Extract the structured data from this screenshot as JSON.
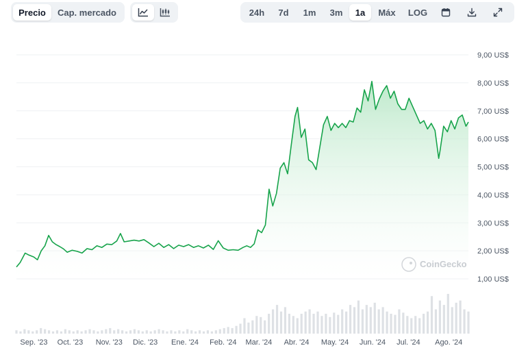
{
  "toolbar": {
    "views": [
      {
        "label": "Precio",
        "active": true
      },
      {
        "label": "Cap. mercado",
        "active": false
      }
    ],
    "chart_types": [
      {
        "icon": "line-chart-icon",
        "active": true
      },
      {
        "icon": "candlestick-chart-icon",
        "active": false
      }
    ],
    "ranges": [
      {
        "label": "24h",
        "active": false
      },
      {
        "label": "7d",
        "active": false
      },
      {
        "label": "1m",
        "active": false
      },
      {
        "label": "3m",
        "active": false
      },
      {
        "label": "1a",
        "active": true
      },
      {
        "label": "Máx",
        "active": false
      }
    ],
    "log_label": "LOG",
    "tools": [
      "calendar-icon",
      "download-icon",
      "fullscreen-icon"
    ]
  },
  "watermark": "CoinGecko",
  "colors": {
    "line": "#16a34a",
    "fill_top": "#b7e7c6",
    "volume": "#d6d9de",
    "grid": "#eef0f3"
  },
  "chart_data": {
    "type": "area",
    "title": "",
    "xlabel": "",
    "ylabel": "",
    "ylim": [
      1.0,
      9.0
    ],
    "y_ticks": [
      1,
      2,
      3,
      4,
      5,
      6,
      7,
      8,
      9
    ],
    "y_tick_labels": [
      "1,00 US$",
      "2,00 US$",
      "3,00 US$",
      "4,00 US$",
      "5,00 US$",
      "6,00 US$",
      "7,00 US$",
      "8,00 US$",
      "9,00 US$"
    ],
    "x_range": [
      "2023-08-29",
      "2024-08-28"
    ],
    "x_ticks": [
      {
        "date": "2023-09-01",
        "label": "Sep. '23"
      },
      {
        "date": "2023-10-01",
        "label": "Oct. '23"
      },
      {
        "date": "2023-11-01",
        "label": "Nov. '23"
      },
      {
        "date": "2023-12-01",
        "label": "Dic. '23"
      },
      {
        "date": "2024-01-01",
        "label": "Ene. '24"
      },
      {
        "date": "2024-02-01",
        "label": "Feb. '24"
      },
      {
        "date": "2024-03-01",
        "label": "Mar. '24"
      },
      {
        "date": "2024-04-01",
        "label": "Abr. '24"
      },
      {
        "date": "2024-05-01",
        "label": "May. '24"
      },
      {
        "date": "2024-06-01",
        "label": "Jun. '24"
      },
      {
        "date": "2024-07-01",
        "label": "Jul. '24"
      },
      {
        "date": "2024-08-01",
        "label": "Ago. '24"
      }
    ],
    "grid": true,
    "legend": "none",
    "series": [
      {
        "x": [
          "2023-08-29",
          "2023-09-01",
          "2023-09-05",
          "2023-09-08",
          "2023-09-12",
          "2023-09-15",
          "2023-09-18",
          "2023-09-21",
          "2023-09-24",
          "2023-09-27",
          "2023-09-30",
          "2023-10-03",
          "2023-10-06",
          "2023-10-09",
          "2023-10-13",
          "2023-10-17",
          "2023-10-21",
          "2023-10-25",
          "2023-10-29",
          "2023-11-02",
          "2023-11-06",
          "2023-11-10",
          "2023-11-14",
          "2023-11-18",
          "2023-11-21",
          "2023-11-24",
          "2023-11-28",
          "2023-12-02",
          "2023-12-06",
          "2023-12-10",
          "2023-12-14",
          "2023-12-18",
          "2023-12-22",
          "2023-12-26",
          "2023-12-30",
          "2024-01-03",
          "2024-01-07",
          "2024-01-11",
          "2024-01-15",
          "2024-01-19",
          "2024-01-23",
          "2024-01-27",
          "2024-01-31",
          "2024-02-04",
          "2024-02-08",
          "2024-02-12",
          "2024-02-16",
          "2024-02-20",
          "2024-02-24",
          "2024-02-28",
          "2024-03-02",
          "2024-03-05",
          "2024-03-08",
          "2024-03-11",
          "2024-03-14",
          "2024-03-17",
          "2024-03-20",
          "2024-03-23",
          "2024-03-26",
          "2024-03-29",
          "2024-04-01",
          "2024-04-04",
          "2024-04-07",
          "2024-04-10",
          "2024-04-12",
          "2024-04-15",
          "2024-04-18",
          "2024-04-21",
          "2024-04-24",
          "2024-04-27",
          "2024-04-30",
          "2024-05-03",
          "2024-05-06",
          "2024-05-09",
          "2024-05-12",
          "2024-05-15",
          "2024-05-18",
          "2024-05-21",
          "2024-05-24",
          "2024-05-27",
          "2024-05-30",
          "2024-06-02",
          "2024-06-05",
          "2024-06-08",
          "2024-06-11",
          "2024-06-14",
          "2024-06-17",
          "2024-06-20",
          "2024-06-23",
          "2024-06-26",
          "2024-06-29",
          "2024-07-02",
          "2024-07-05",
          "2024-07-08",
          "2024-07-11",
          "2024-07-14",
          "2024-07-17",
          "2024-07-20",
          "2024-07-23",
          "2024-07-26",
          "2024-07-29",
          "2024-08-01",
          "2024-08-04",
          "2024-08-05",
          "2024-08-08",
          "2024-08-11",
          "2024-08-14",
          "2024-08-17",
          "2024-08-20",
          "2024-08-23",
          "2024-08-26",
          "2024-08-28"
        ],
        "y": [
          1.42,
          1.58,
          1.92,
          1.85,
          1.78,
          1.68,
          2.0,
          2.18,
          2.55,
          2.32,
          2.22,
          2.15,
          2.07,
          1.95,
          2.02,
          1.98,
          1.92,
          2.08,
          2.04,
          2.18,
          2.12,
          2.24,
          2.22,
          2.35,
          2.62,
          2.32,
          2.35,
          2.38,
          2.35,
          2.4,
          2.28,
          2.15,
          2.27,
          2.12,
          2.22,
          2.08,
          2.2,
          2.15,
          2.22,
          2.12,
          2.18,
          2.1,
          2.2,
          2.05,
          2.36,
          2.1,
          2.02,
          2.04,
          2.02,
          2.12,
          2.18,
          2.12,
          2.25,
          2.75,
          2.65,
          2.92,
          4.2,
          3.6,
          4.05,
          4.95,
          5.15,
          4.75,
          5.8,
          6.8,
          7.12,
          6.05,
          6.35,
          5.25,
          5.15,
          4.9,
          5.7,
          6.5,
          6.8,
          6.3,
          6.55,
          6.4,
          6.55,
          6.4,
          6.65,
          6.6,
          7.1,
          6.95,
          7.75,
          7.35,
          8.05,
          7.05,
          7.42,
          7.7,
          7.9,
          7.45,
          7.7,
          7.25,
          7.05,
          7.05,
          7.45,
          7.15,
          6.85,
          6.55,
          6.65,
          6.35,
          6.55,
          6.3,
          5.3,
          5.55,
          6.45,
          6.25,
          6.65,
          6.35,
          6.75,
          6.85,
          6.45,
          6.6
        ]
      }
    ],
    "volume": {
      "note_free": true,
      "x_start": "2023-08-29",
      "x_end": "2024-08-28",
      "values": [
        3,
        2,
        4,
        3,
        2,
        3,
        5,
        4,
        3,
        2,
        3,
        2,
        4,
        3,
        2,
        3,
        2,
        3,
        4,
        3,
        2,
        3,
        4,
        5,
        3,
        4,
        3,
        2,
        3,
        4,
        3,
        2,
        3,
        2,
        3,
        4,
        3,
        2,
        3,
        2,
        3,
        2,
        4,
        3,
        2,
        3,
        2,
        3,
        2,
        3,
        4,
        5,
        6,
        5,
        7,
        9,
        14,
        10,
        12,
        16,
        15,
        12,
        18,
        22,
        26,
        20,
        24,
        18,
        16,
        14,
        18,
        20,
        22,
        18,
        20,
        16,
        18,
        15,
        19,
        17,
        22,
        20,
        26,
        24,
        30,
        22,
        26,
        24,
        28,
        22,
        24,
        20,
        18,
        17,
        22,
        19,
        16,
        14,
        16,
        14,
        18,
        20,
        34,
        22,
        30,
        26,
        36,
        24,
        28,
        30,
        22,
        20
      ]
    }
  }
}
